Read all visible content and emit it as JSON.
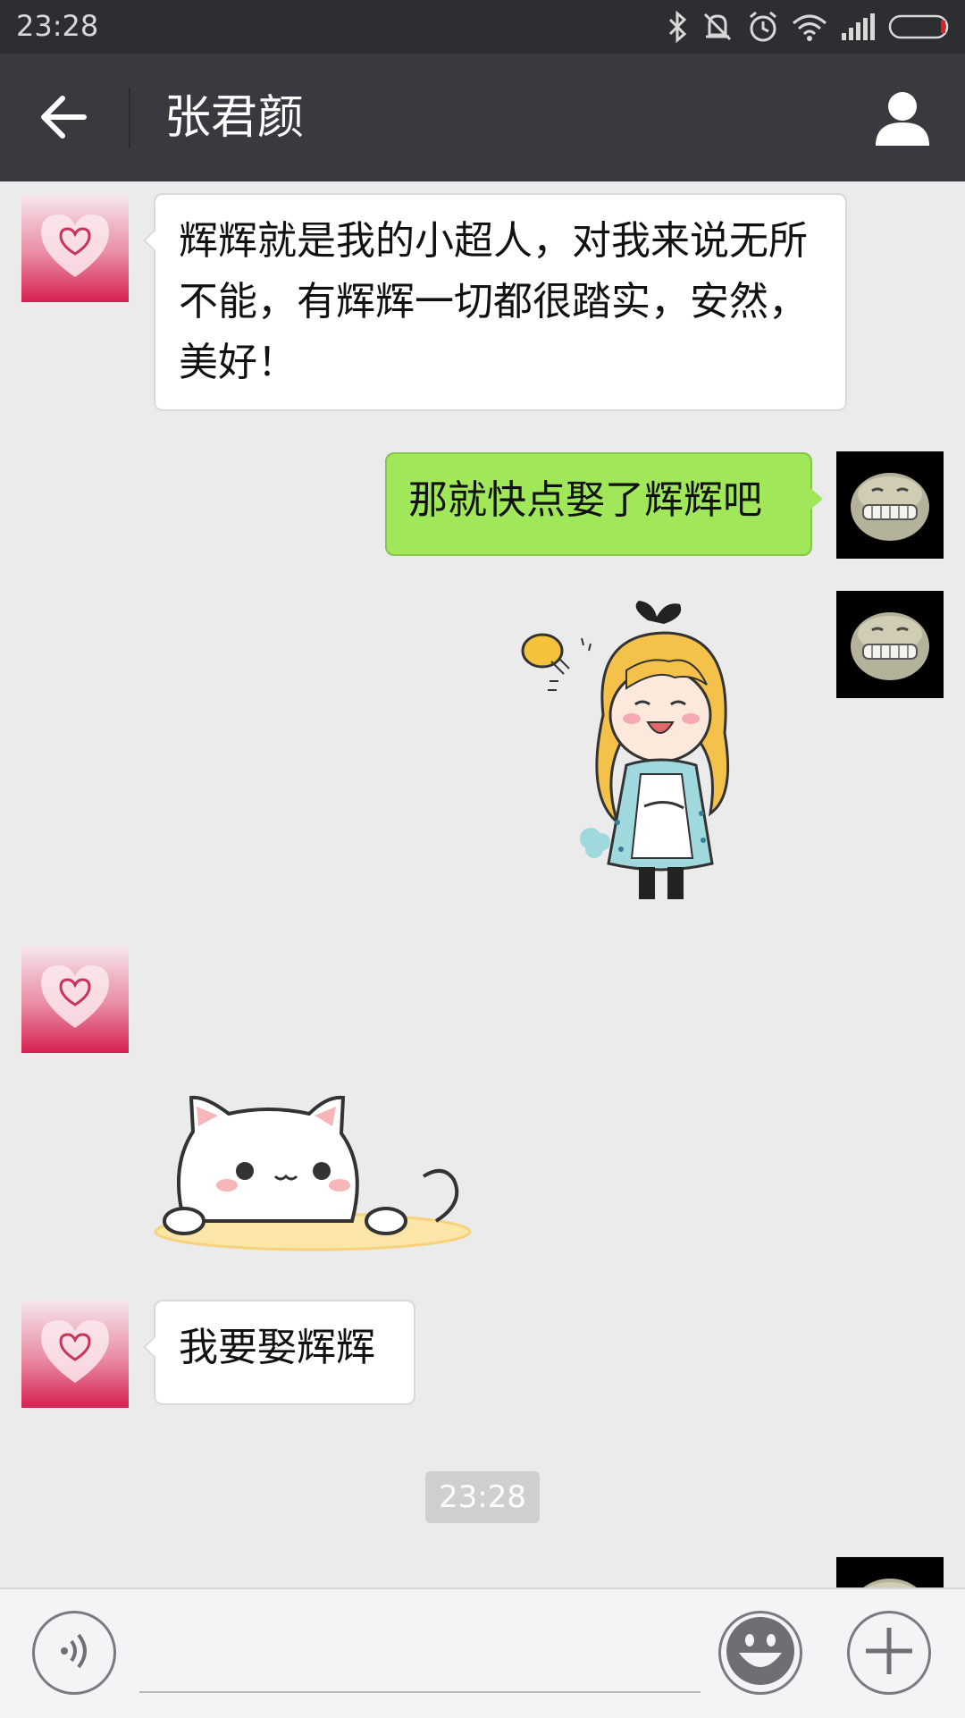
{
  "status_bar": {
    "time": "23:28",
    "icons": [
      "bluetooth-icon",
      "muted-icon",
      "alarm-icon",
      "wifi-icon",
      "signal-icon",
      "battery-icon"
    ]
  },
  "header": {
    "title": "张君颜",
    "back_icon": "arrow-left-icon",
    "profile_icon": "person-icon"
  },
  "messages": [
    {
      "from": "contact",
      "type": "text",
      "text": "辉辉就是我的小超人，对我来说无所不能，有辉辉一切都很踏实，安然，美好！"
    },
    {
      "from": "me",
      "type": "text",
      "text": "那就快点娶了辉辉吧"
    },
    {
      "from": "me",
      "type": "sticker",
      "sticker": "blonde-girl-sticker"
    },
    {
      "from": "contact",
      "type": "sticker",
      "sticker": "white-cat-sticker"
    },
    {
      "from": "contact",
      "type": "text",
      "text": "我要娶辉辉"
    }
  ],
  "timestamp": "23:28",
  "input_bar": {
    "voice_icon": "voice-icon",
    "emoji_icon": "smiley-icon",
    "plus_icon": "plus-icon",
    "placeholder": ""
  },
  "colors": {
    "header_bg": "#393a3f",
    "status_bg": "#2d2e32",
    "chat_bg": "#ebebeb",
    "outgoing_bubble": "#a0e75a",
    "incoming_bubble": "#ffffff"
  }
}
